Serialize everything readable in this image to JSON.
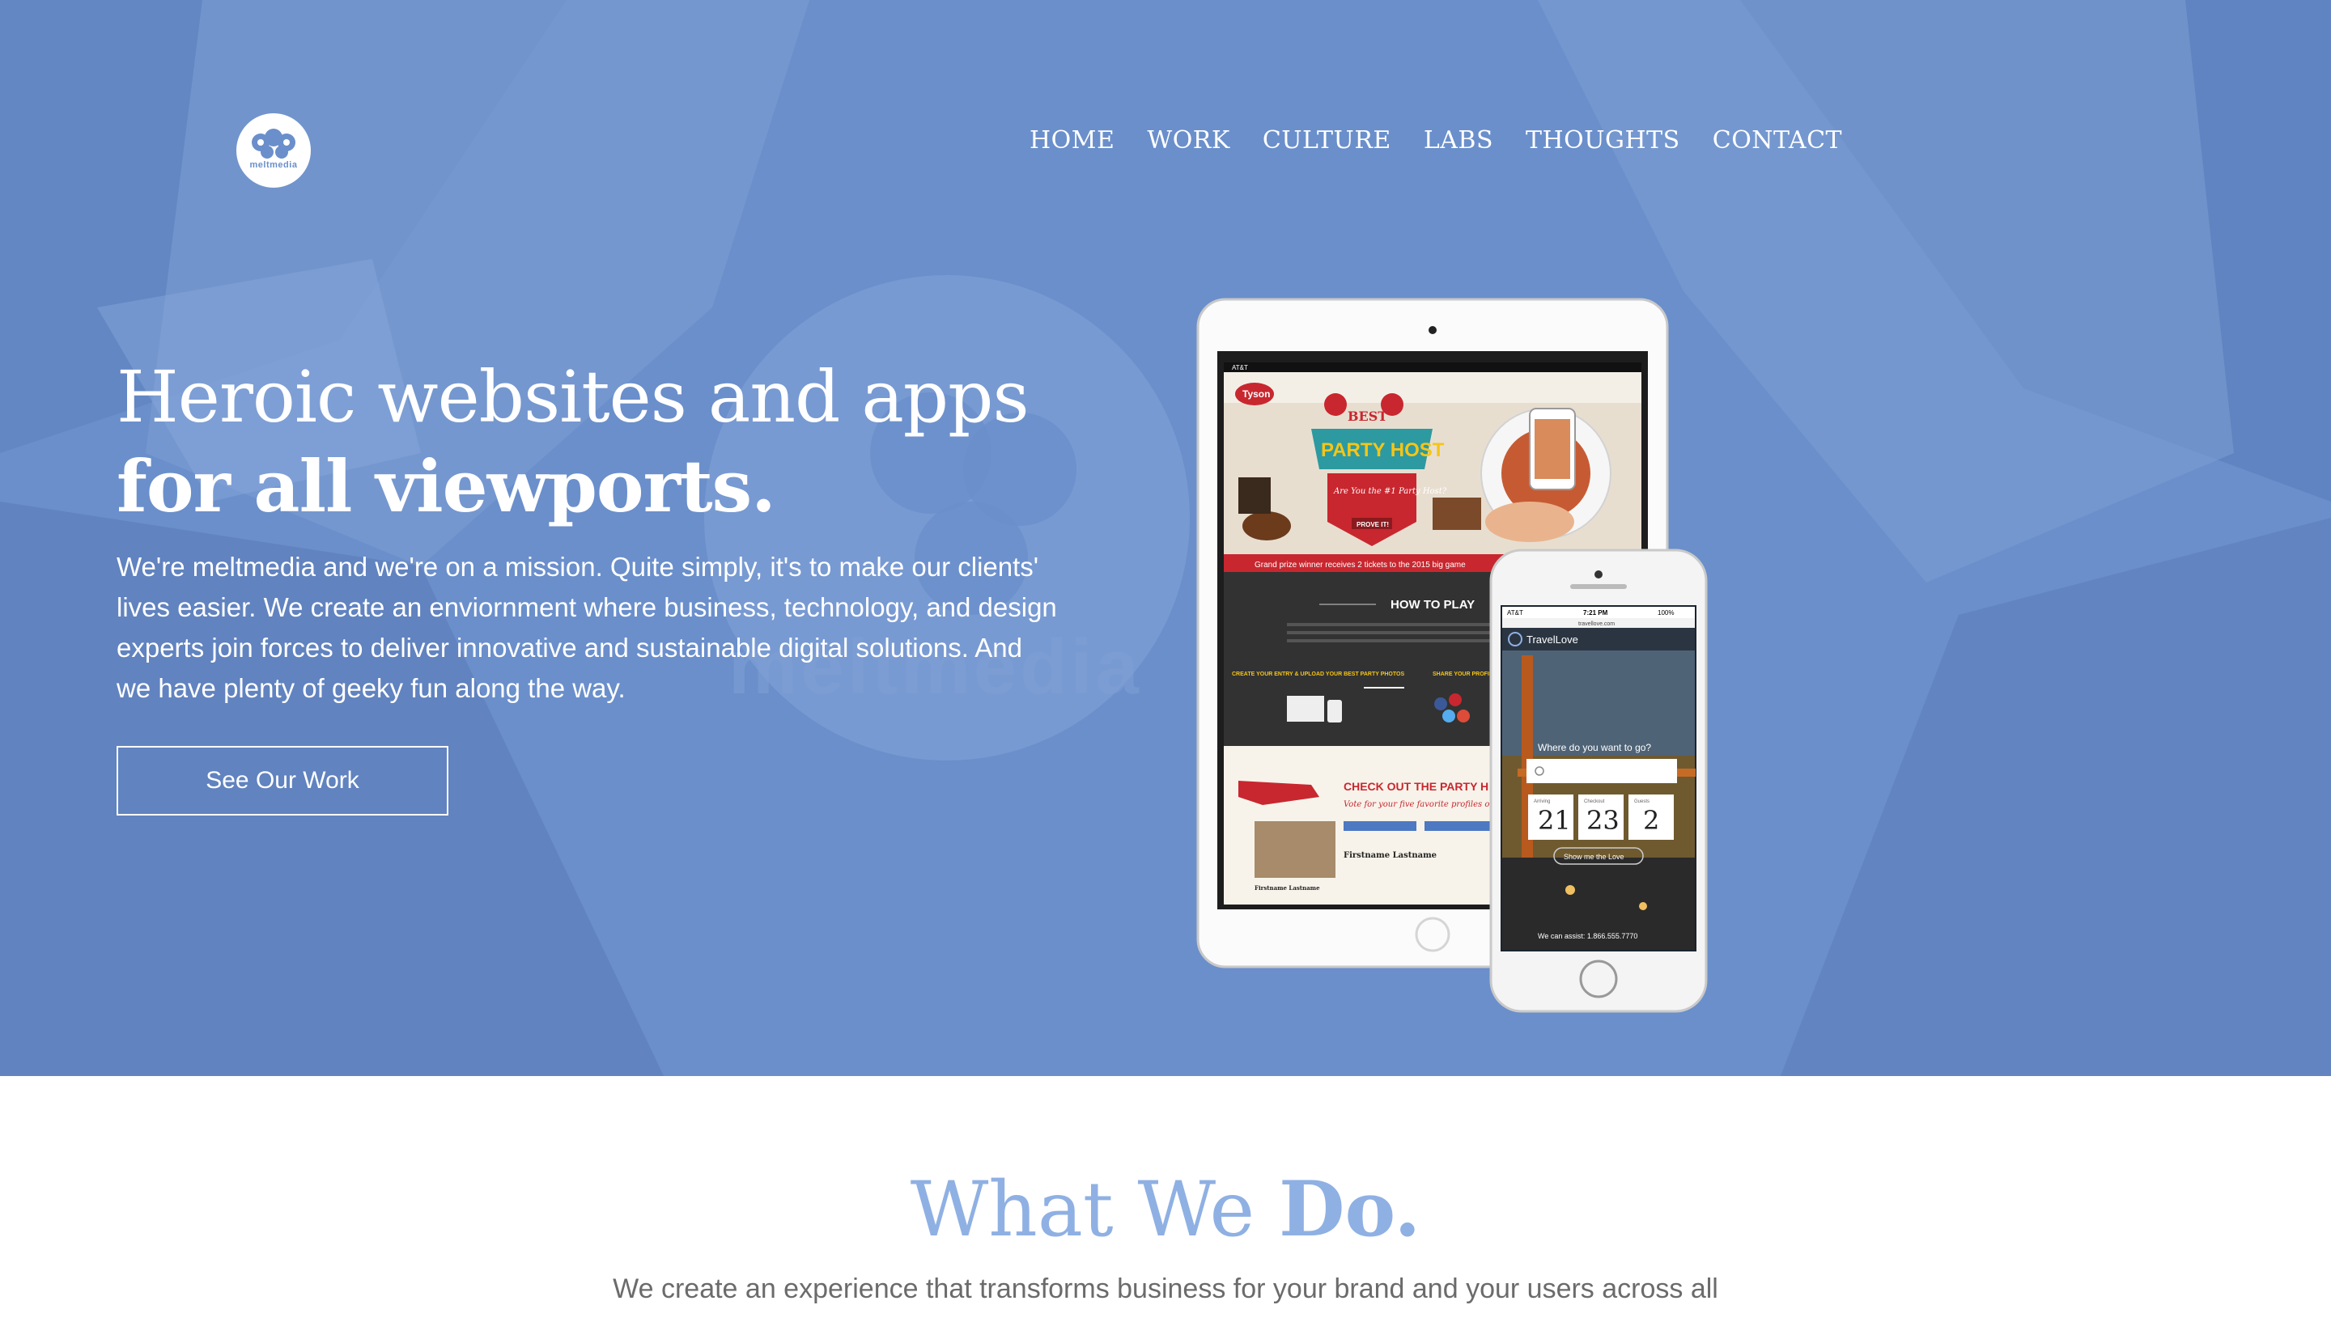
{
  "brand": {
    "logo_text": "meltmedia"
  },
  "nav": {
    "items": [
      {
        "label": "HOME"
      },
      {
        "label": "WORK"
      },
      {
        "label": "CULTURE"
      },
      {
        "label": "LABS"
      },
      {
        "label": "THOUGHTS"
      },
      {
        "label": "CONTACT"
      }
    ]
  },
  "hero": {
    "headline_line1": "Heroic websites and apps",
    "headline_line2": "for all viewports.",
    "intro": "We're meltmedia and we're on a mission. Quite simply, it's to make our clients' lives easier. We create an enviornment where business, technology, and design experts join forces to deliver innovative and sustainable digital solutions. And we have plenty of geeky fun along the way.",
    "cta_label": "See Our Work",
    "background_watermark": "meltmedia"
  },
  "tablet_screen": {
    "brand": "Tyson",
    "badge_top": "BEST",
    "badge_main": "PARTY HOST",
    "badge_question": "Are You the #1 Party Host?",
    "badge_button": "PROVE IT!",
    "ribbon": "Grand prize winner receives 2 tickets to the 2015 big game",
    "how_to_play": "HOW TO PLAY",
    "step1": "CREATE YOUR ENTRY & UPLOAD YOUR BEST PARTY PHOTOS",
    "step2": "SHARE YOUR PROFILE TO GET VOTES FROM FRIENDS & FAMILY",
    "check_out": "CHECK OUT THE PARTY H",
    "vote_line": "Vote for your five favorite profiles onc",
    "entry_name1": "Firstname Lastname",
    "entry_name2": "Firstname Lastname"
  },
  "phone_screen": {
    "carrier": "AT&T",
    "time": "7:21 PM",
    "battery": "100%",
    "url": "travellove.com",
    "app_name": "TravelLove",
    "prompt": "Where do you want to go?",
    "date1": "21",
    "date2": "23",
    "guests": "2",
    "date1_label": "Arriving",
    "date2_label": "Checkout",
    "guests_label": "Guests",
    "button": "Show me the Love",
    "assist": "We can assist: 1.866.555.7770"
  },
  "what_we_do": {
    "title_light": "What We ",
    "title_bold": "Do.",
    "body": "We create an experience that transforms business for your brand and your users across all"
  },
  "colors": {
    "hero_blue": "#6a8fcb",
    "heading_blue": "#8fb0e3",
    "tyson_red": "#c8272f"
  }
}
